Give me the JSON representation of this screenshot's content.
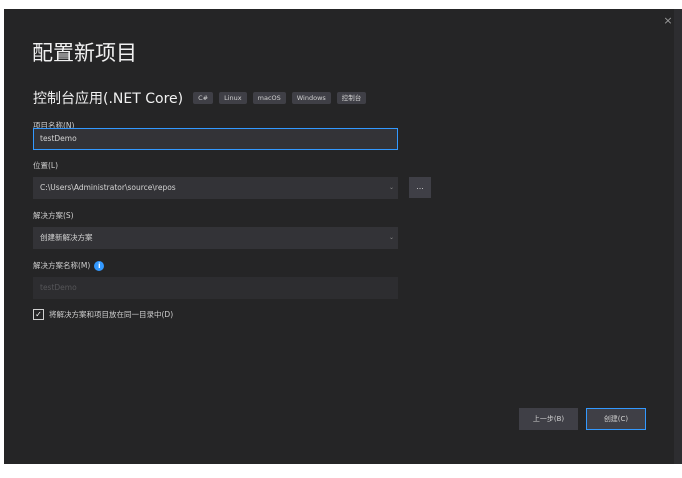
{
  "dialog": {
    "title": "配置新项目",
    "close_glyph": "×",
    "template": {
      "name": "控制台应用(.NET Core)",
      "tags": [
        "C#",
        "Linux",
        "macOS",
        "Windows",
        "控制台"
      ]
    },
    "project_name": {
      "label": "项目名称(N)",
      "value": "testDemo"
    },
    "location": {
      "label": "位置(L)",
      "value": "C:\\Users\\Administrator\\source\\repos",
      "browse_label": "..."
    },
    "solution": {
      "label": "解决方案(S)",
      "value": "创建新解决方案"
    },
    "solution_name": {
      "label": "解决方案名称(M)",
      "info_glyph": "i",
      "placeholder": "testDemo"
    },
    "same_directory": {
      "label": "将解决方案和项目放在同一目录中(D)",
      "checked": true,
      "check_glyph": "✓"
    },
    "buttons": {
      "back": "上一步(B)",
      "create": "创建(C)"
    },
    "dropdown_glyph": "⌄"
  },
  "colors": {
    "background": "#252526",
    "input_background": "#333337",
    "accent": "#3399ff",
    "text": "#f1f1f1",
    "tag_background": "#3f3f46"
  }
}
